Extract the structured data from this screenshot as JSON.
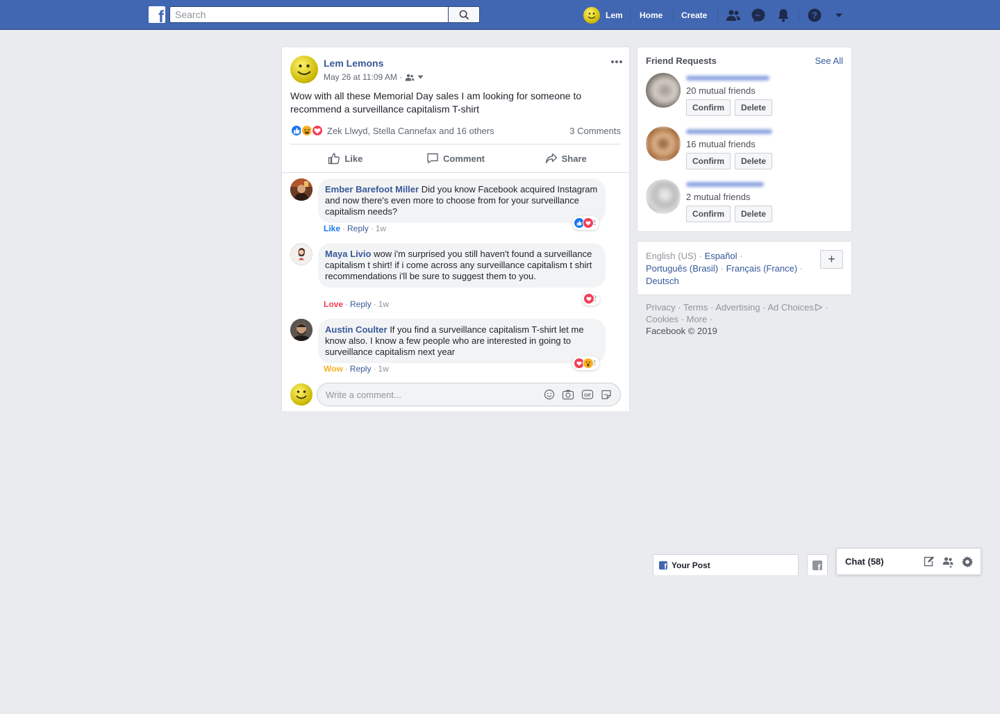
{
  "search": {
    "placeholder": "Search"
  },
  "nav": {
    "user": "Lem",
    "home": "Home",
    "create": "Create"
  },
  "post": {
    "author": "Lem Lemons",
    "time": "May 26 at 11:09 AM ·",
    "text": "Wow with all these Memorial Day sales I am looking for someone to recommend a surveillance capitalism T-shirt",
    "reaction_names": "Zek Llwyd, Stella Cannefax and 16 others",
    "comments_count": "3 Comments",
    "like": "Like",
    "comment": "Comment",
    "share": "Share"
  },
  "comments": [
    {
      "author": "Ember Barefoot Miller",
      "text": "Did you know Facebook acquired Instagram and now there's even more to choose from for your surveillance capitalism needs?",
      "action": "Like",
      "reply": "Reply",
      "time": "1w",
      "react_count": "2"
    },
    {
      "author": "Maya Livio",
      "text": "wow i'm surprised you still haven't found a surveillance capitalism t shirt! if i come across any surveillance capitalism t shirt recommendations i'll be sure to suggest them to you.",
      "action": "Love",
      "reply": "Reply",
      "time": "1w",
      "react_count": "2"
    },
    {
      "author": "Austin Coulter",
      "text": "If you find a surveillance capitalism T-shirt let me know also. I know a few people who are interested in going to surveillance capitalism next year",
      "action": "Wow",
      "reply": "Reply",
      "time": "1w",
      "react_count": "2"
    }
  ],
  "write_comment": {
    "placeholder": "Write a comment..."
  },
  "friend_requests": {
    "title": "Friend Requests",
    "see_all": "See All",
    "items": [
      {
        "mutual": "20 mutual friends",
        "confirm": "Confirm",
        "delete": "Delete"
      },
      {
        "mutual": "16 mutual friends",
        "confirm": "Confirm",
        "delete": "Delete"
      },
      {
        "mutual": "2 mutual friends",
        "confirm": "Confirm",
        "delete": "Delete"
      }
    ]
  },
  "languages": {
    "current": "English (US)",
    "l1": "Español",
    "l2": "Português (Brasil)",
    "l3": "Français (France)",
    "l4": "Deutsch",
    "plus": "+"
  },
  "footer": {
    "privacy": "Privacy",
    "terms": "Terms",
    "advertising": "Advertising",
    "ad_choices": "Ad Choices",
    "cookies": "Cookies",
    "more": "More",
    "copyright": "Facebook © 2019"
  },
  "bottom": {
    "your_post": "Your Post",
    "chat": "Chat (58)"
  },
  "colors": {
    "brand": "#4267b2",
    "link": "#385898",
    "love": "#f33e58",
    "wow": "#f7b125",
    "like": "#1877f2"
  }
}
